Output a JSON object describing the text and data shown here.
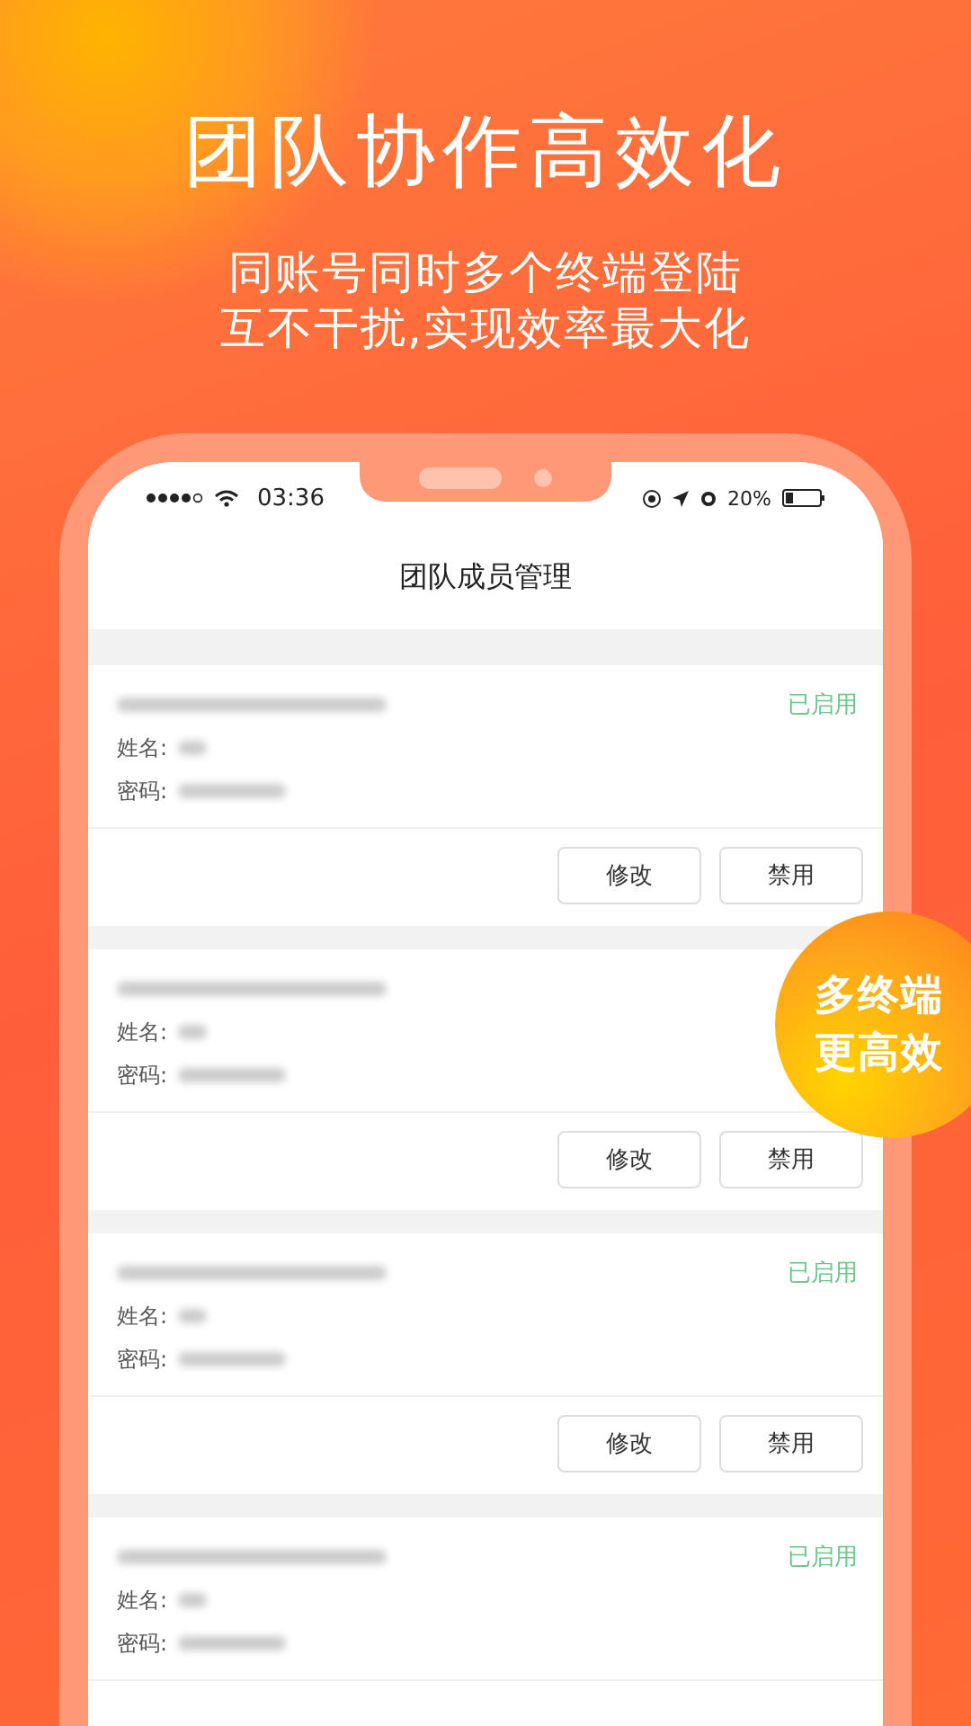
{
  "headline": "团队协作高效化",
  "subtitle": [
    "同账号同时多个终端登陆",
    "互不干扰,实现效率最大化"
  ],
  "status_bar": {
    "time": "03:36",
    "battery": "20%"
  },
  "screen_title": "团队成员管理",
  "members": [
    {
      "status": "已启用",
      "name_label": "姓名:",
      "password_label": "密码:",
      "buttons": [
        "修改",
        "禁用"
      ]
    },
    {
      "name_label": "姓名:",
      "password_label": "密码:",
      "buttons": [
        "修改",
        "禁用"
      ]
    },
    {
      "status": "已启用",
      "name_label": "姓名:",
      "password_label": "密码:",
      "buttons": [
        "修改",
        "禁用"
      ]
    },
    {
      "status": "已启用",
      "name_label": "姓名:",
      "password_label": "密码:"
    }
  ],
  "badge": [
    "多终端",
    "更高效"
  ]
}
